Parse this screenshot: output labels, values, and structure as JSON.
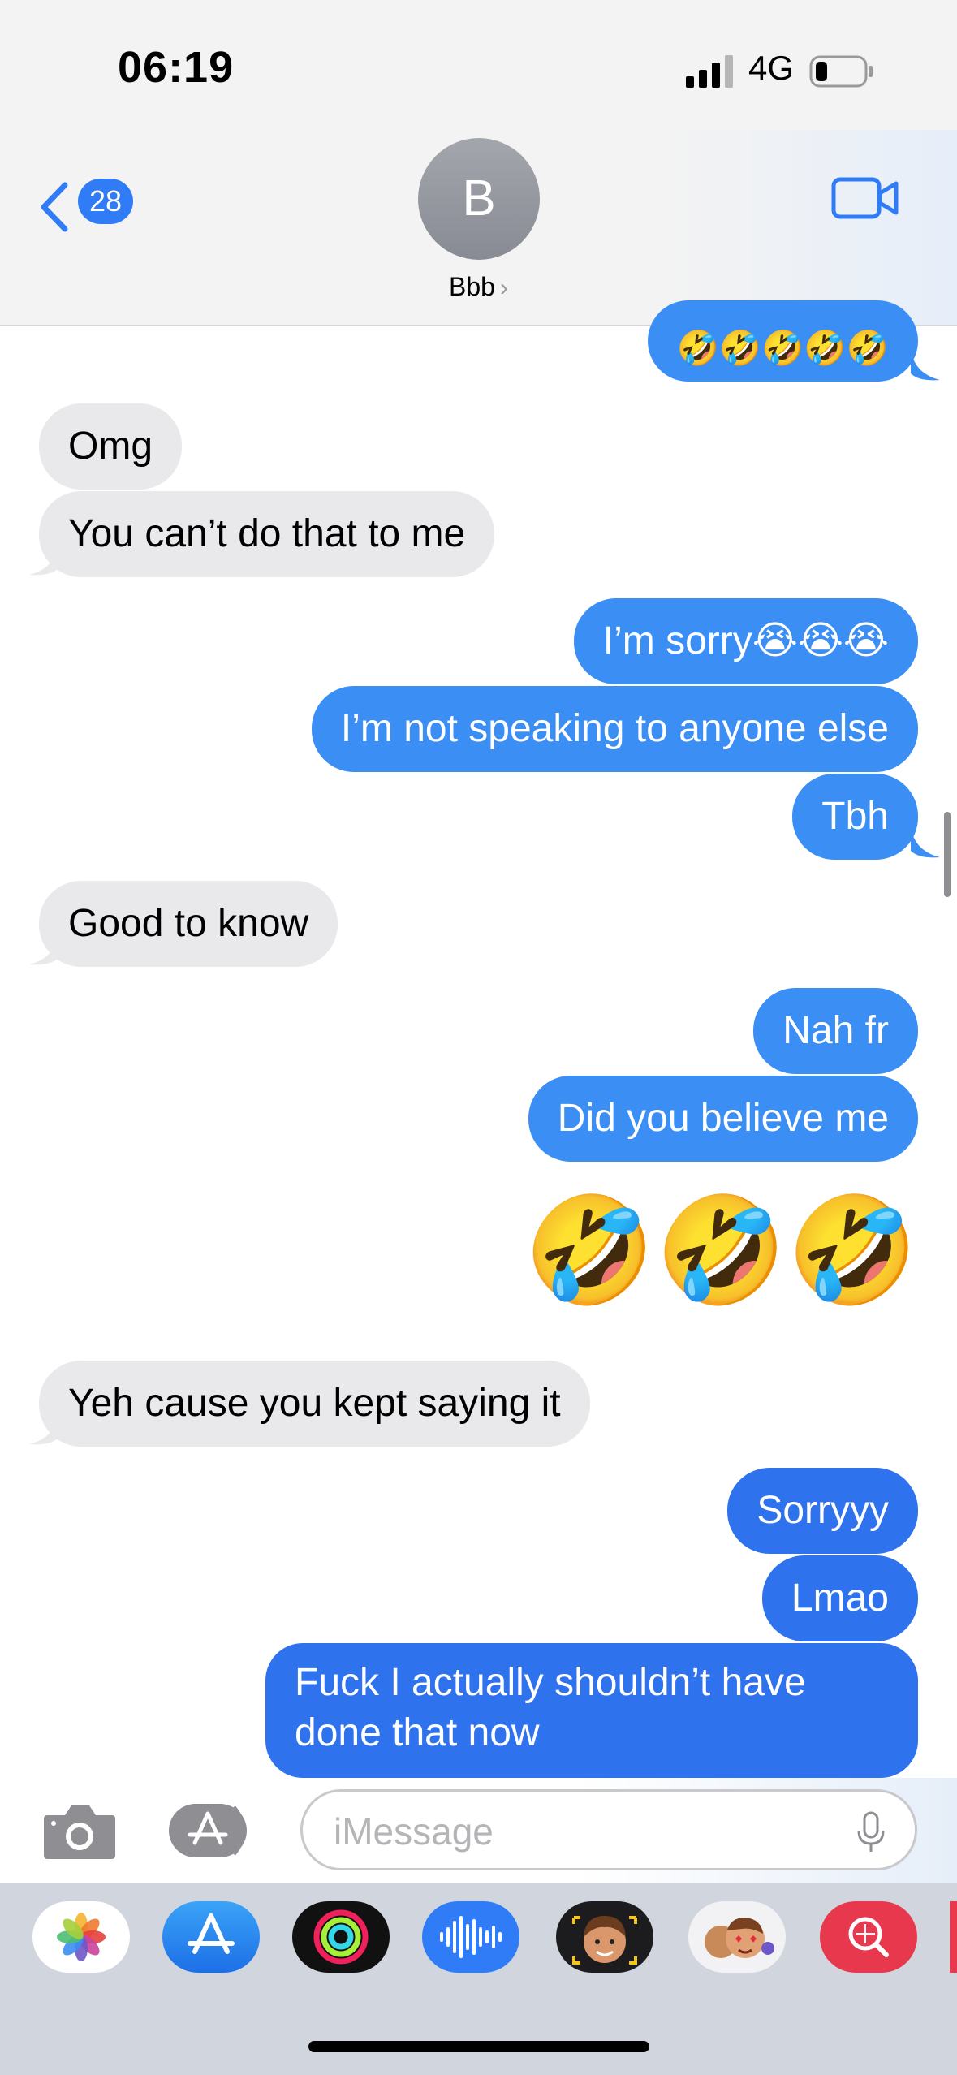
{
  "status_bar": {
    "time": "06:19",
    "network": "4G"
  },
  "header": {
    "unread_count": "28",
    "avatar_initial": "B",
    "contact_name": "Bbb",
    "chevron": "›"
  },
  "messages": [
    {
      "side": "out",
      "text": "🤣🤣🤣🤣🤣"
    },
    {
      "side": "in",
      "text": "Omg"
    },
    {
      "side": "in",
      "text": "You can’t do that to me"
    },
    {
      "side": "out",
      "text": "I’m sorry😭😭😭"
    },
    {
      "side": "out",
      "text": "I’m not speaking to anyone else"
    },
    {
      "side": "out",
      "text": "Tbh"
    },
    {
      "side": "in",
      "text": "Good to know"
    },
    {
      "side": "out",
      "text": "Nah fr"
    },
    {
      "side": "out",
      "text": "Did you believe me"
    },
    {
      "side": "out",
      "text": "🤣🤣🤣"
    },
    {
      "side": "in",
      "text": "Yeh cause you kept saying it"
    },
    {
      "side": "out",
      "text": "Sorryyy"
    },
    {
      "side": "out",
      "text": "Lmao"
    },
    {
      "side": "out",
      "text": "Fuck I actually shouldn’t have done that now"
    }
  ],
  "input": {
    "placeholder": "iMessage"
  },
  "app_tray": [
    {
      "name": "photos-app-icon"
    },
    {
      "name": "app-store-icon"
    },
    {
      "name": "fitness-activity-icon"
    },
    {
      "name": "audio-message-icon"
    },
    {
      "name": "memoji-icon"
    },
    {
      "name": "memoji-stickers-icon"
    },
    {
      "name": "image-search-icon"
    }
  ],
  "colors": {
    "outgoing": "#3b8ef3",
    "incoming": "#e9e9eb",
    "accent": "#2f7cf6"
  }
}
